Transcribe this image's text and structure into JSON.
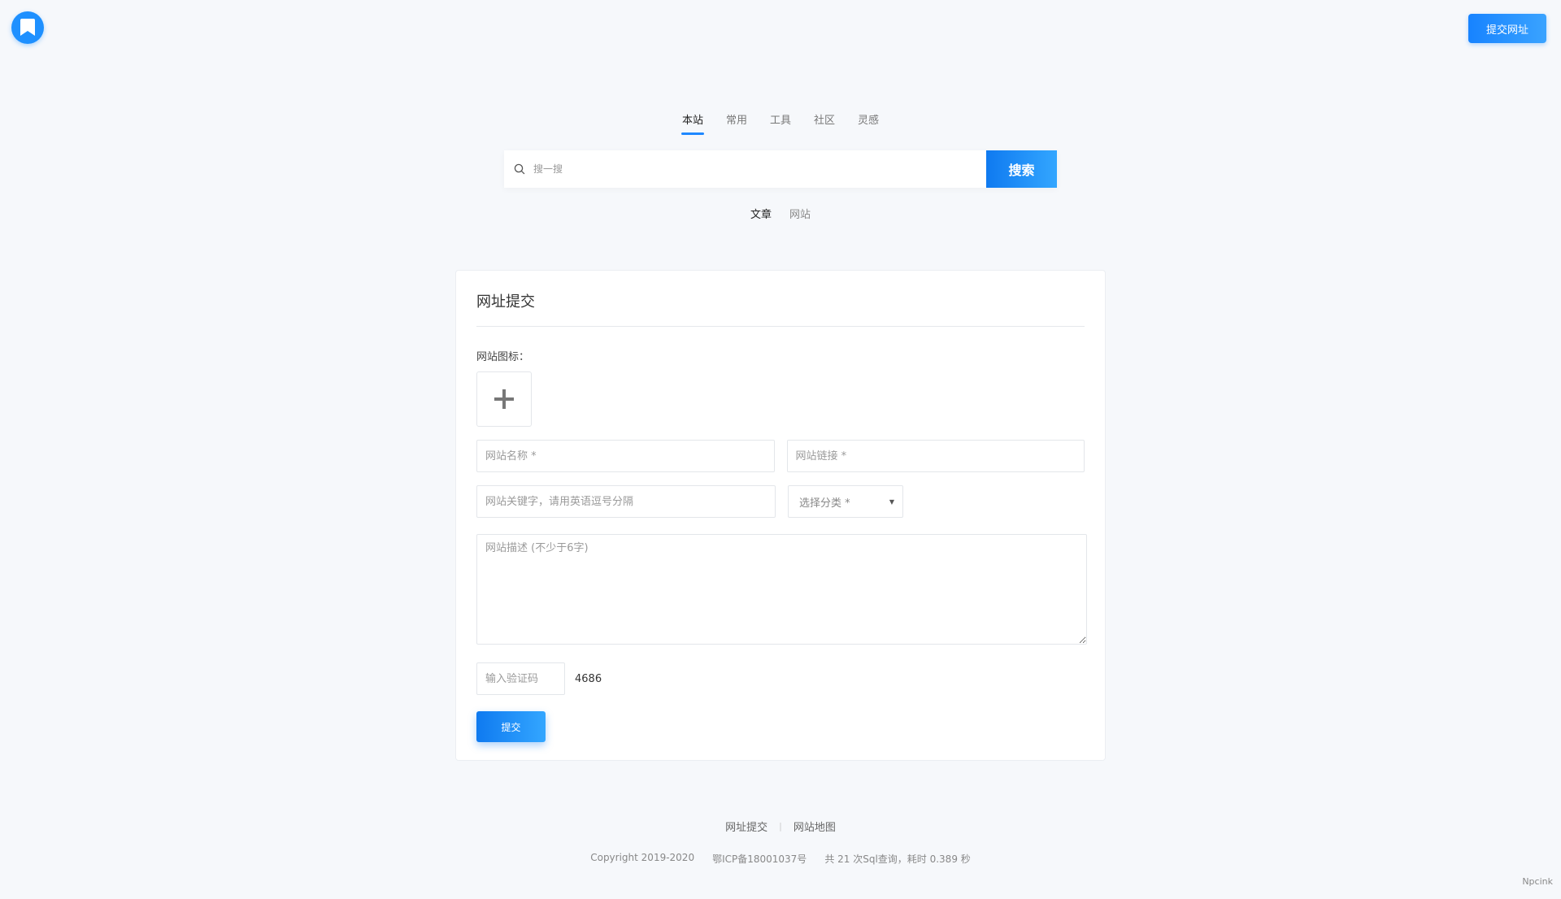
{
  "header": {
    "logo_icon": "bookmark-icon",
    "submit_button": "提交网址"
  },
  "search": {
    "tabs": [
      "本站",
      "常用",
      "工具",
      "社区",
      "灵感"
    ],
    "active_tab": "本站",
    "placeholder": "搜一搜",
    "button": "搜索",
    "sub_tabs": [
      "文章",
      "网站"
    ],
    "active_sub_tab": "文章"
  },
  "form": {
    "title": "网址提交",
    "icon_label": "网站图标：",
    "upload_icon": "plus-icon",
    "name_placeholder": "网站名称 *",
    "url_placeholder": "网站链接 *",
    "keywords_placeholder": "网站关键字，请用英语逗号分隔",
    "category_select": "选择分类 *",
    "description_placeholder": "网站描述 (不少于6字)",
    "captcha_placeholder": "输入验证码",
    "captcha_code": "4686",
    "submit": "提交"
  },
  "footer": {
    "links": [
      "网址提交",
      "网站地图"
    ],
    "copyright": "Copyright 2019-2020",
    "icp": "鄂ICP备18001037号",
    "stats": "共 21 次Sql查询，耗时 0.389 秒",
    "credit": "Npcink"
  },
  "colors": {
    "accent": "#1e88ff",
    "background": "#f6f8fb"
  }
}
